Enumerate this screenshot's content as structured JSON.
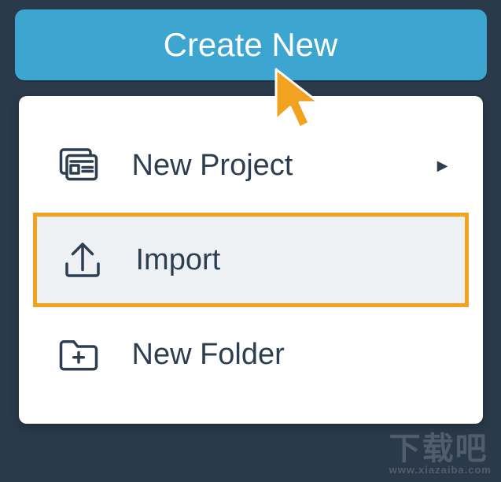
{
  "create_button": {
    "label": "Create New"
  },
  "menu": {
    "new_project": {
      "label": "New Project",
      "has_submenu": true
    },
    "import": {
      "label": "Import",
      "highlighted": true
    },
    "new_folder": {
      "label": "New Folder"
    }
  },
  "watermark": {
    "main": "下载吧",
    "sub": "www.xiazaiba.com"
  }
}
